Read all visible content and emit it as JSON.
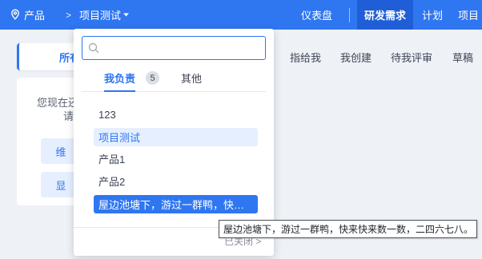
{
  "topbar": {
    "product_label": "产品",
    "separator": ">",
    "project_label": "项目测试",
    "nav": {
      "dashboard": "仪表盘",
      "requirements": "研发需求",
      "plan": "计划",
      "project": "项目"
    }
  },
  "subtabs": {
    "all": "所有",
    "assigned": "指给我",
    "created": "我创建",
    "review": "待我评审",
    "draft": "草稿"
  },
  "card": {
    "text1": "您现在还",
    "text2": "请",
    "button1": "维",
    "button2": "显"
  },
  "dropdown": {
    "search_placeholder": "",
    "tabs": {
      "mine": "我负责",
      "mine_count": "5",
      "other": "其他"
    },
    "items": [
      "123",
      "项目测试",
      "产品1",
      "产品2",
      "屋边池塘下，游过一群鸭，快…"
    ],
    "closed_label": "已关闭 >"
  },
  "tooltip": "屋边池塘下，游过一群鸭，快来快来数一数，二四六七八。",
  "colors": {
    "primary": "#2f76f1",
    "active_nav": "#1f5ed6",
    "selected_item_bg": "#e6efff"
  }
}
